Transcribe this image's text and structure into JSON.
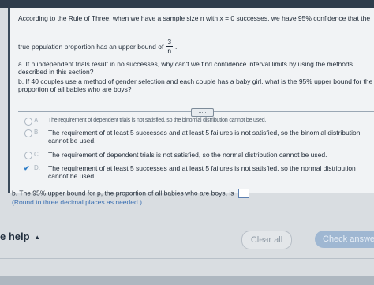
{
  "question": {
    "intro_line1": "According to the Rule of Three, when we have a sample size n with x = 0 successes, we have 95% confidence that the",
    "intro_line2": "true population proportion has an upper bound of",
    "fraction_numerator": "3",
    "fraction_denominator": "n",
    "intro_end": ".",
    "part_a": "a. If n independent trials result in no successes, why can't we find confidence interval limits by using the methods described in this section?",
    "part_b": "b. If 40 couples use a method of gender selection and each couple has a baby girl, what is the 95% upper bound for the proportion of all babies who are boys?",
    "more_button": "....."
  },
  "options": [
    {
      "letter": "A.",
      "text": "The requirement of dependent trials is not satisfied, so the binomial distribution cannot be used.",
      "selected": false
    },
    {
      "letter": "B.",
      "text": "The requirement of at least 5 successes and at least 5 failures is not satisfied, so the binomial distribution cannot be used.",
      "selected": false
    },
    {
      "letter": "C.",
      "text": "The requirement of dependent trials is not satisfied, so the normal distribution cannot be used.",
      "selected": false
    },
    {
      "letter": "D.",
      "text": "The requirement of at least 5 successes and at least 5 failures is not satisfied, so the normal distribution cannot be used.",
      "selected": true
    }
  ],
  "answer_b": {
    "prompt": "b. The 95% upper bound for p, the proportion of all babies who are boys, is",
    "note": "(Round to three decimal places as needed.)"
  },
  "footer": {
    "help": "e help",
    "help_caret": "▲",
    "clear_all": "Clear all",
    "check_answer": "Check answer"
  }
}
